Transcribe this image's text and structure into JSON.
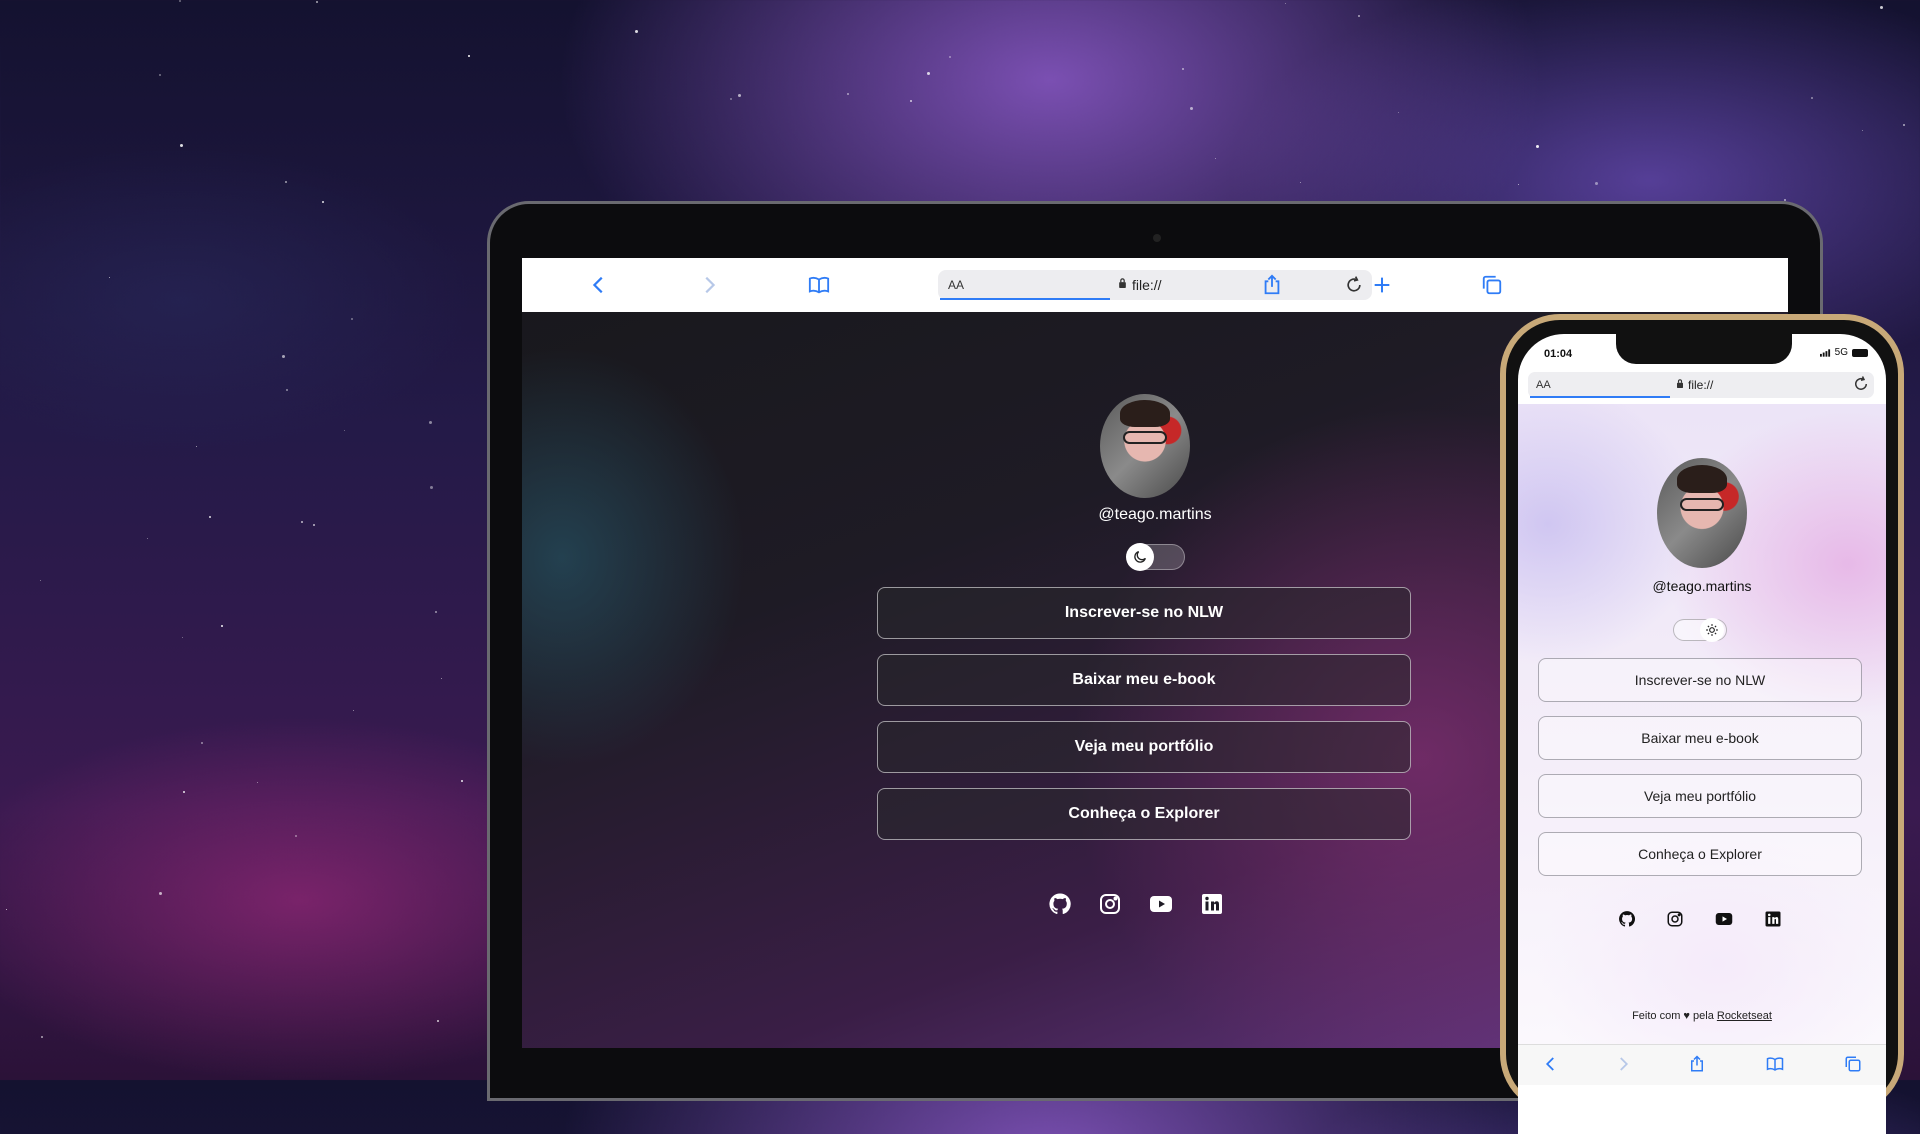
{
  "browser": {
    "url_aa": "AA",
    "url": "file://"
  },
  "profile": {
    "handle": "@teago.martins"
  },
  "links": [
    {
      "label": "Inscrever-se no NLW"
    },
    {
      "label": "Baixar meu e-book"
    },
    {
      "label": "Veja meu portfólio"
    },
    {
      "label": "Conheça o Explorer"
    }
  ],
  "social_icons": [
    "github-icon",
    "instagram-icon",
    "youtube-icon",
    "linkedin-icon"
  ],
  "phone": {
    "time": "01:04",
    "network": "5G",
    "footer_prefix": "Feito com ♥ pela ",
    "footer_link": "Rocketseat"
  },
  "colors": {
    "accent": "#2f7cf6",
    "phone_frame": "#c8a978"
  }
}
